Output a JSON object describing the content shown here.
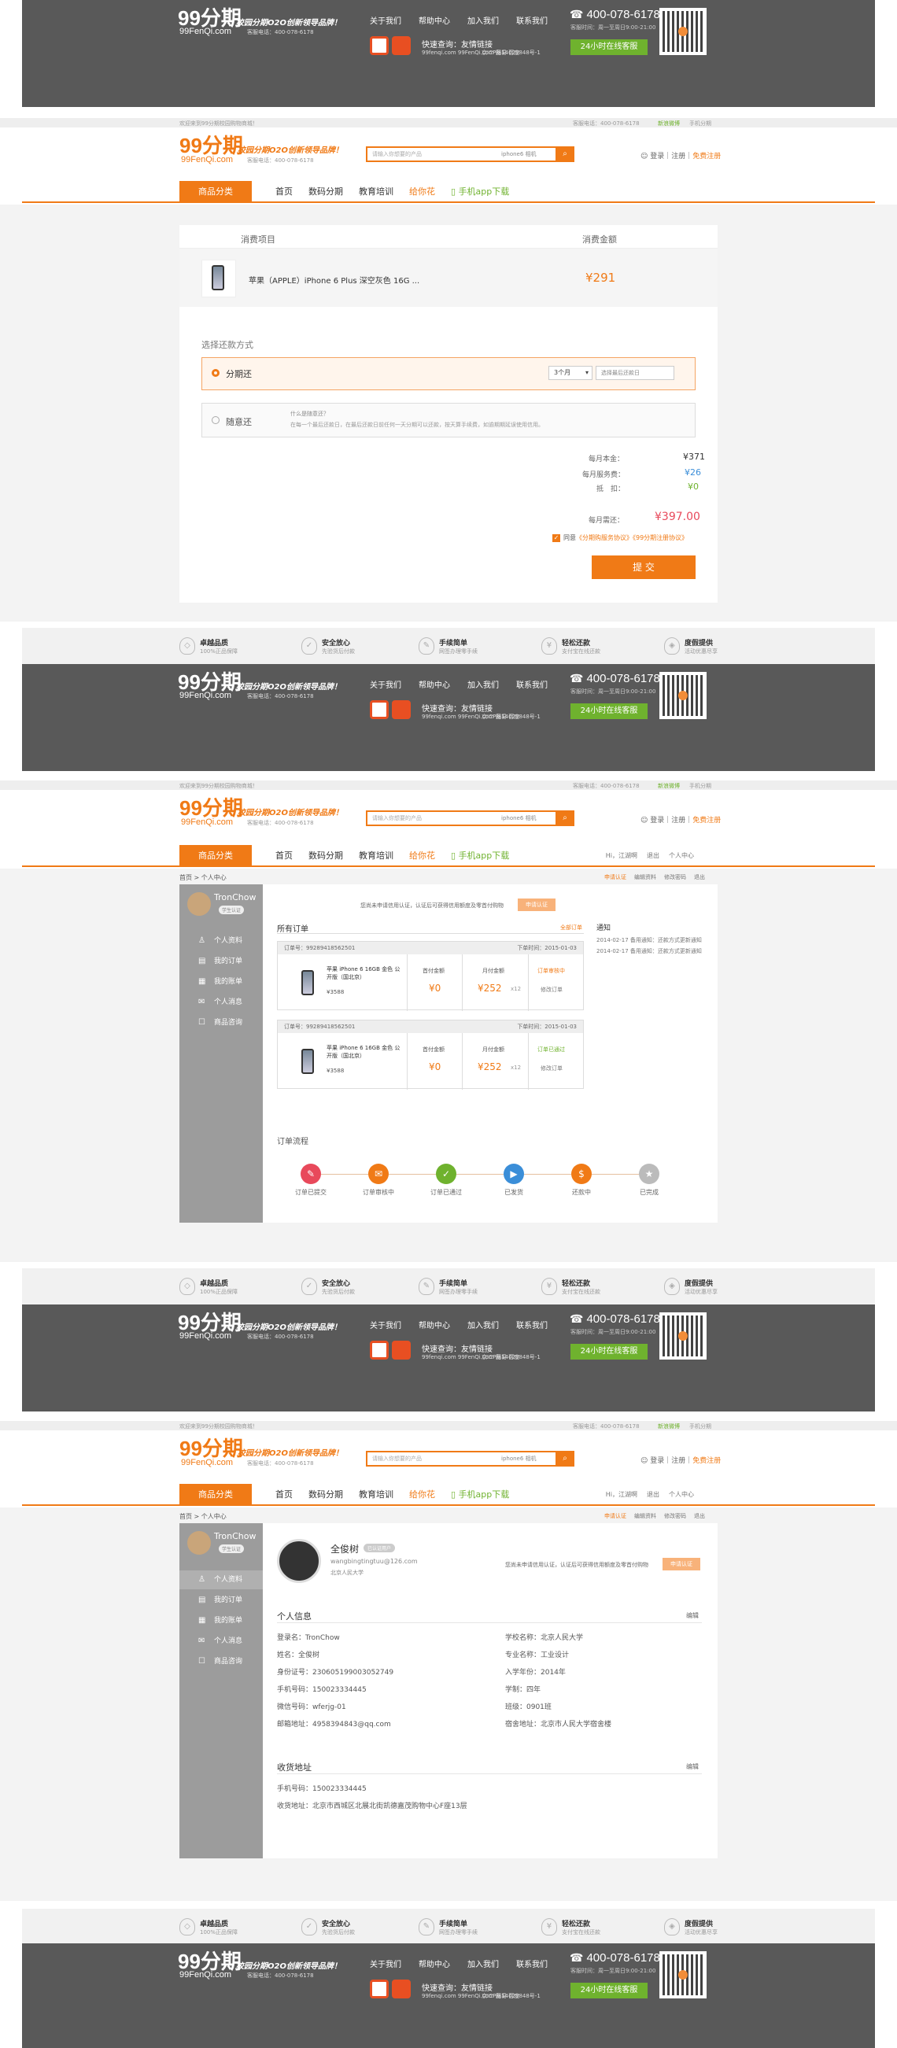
{
  "brand": {
    "logo": "99分期",
    "logo_sub": "99FenQi.com",
    "slogan": "校园分期O2O创新领导品牌！",
    "hotline_label": "客服电话：400-078-6178"
  },
  "footer": {
    "nav": [
      "关于我们",
      "帮助中心",
      "加入我们",
      "联系我们"
    ],
    "friend_label": "快速查询：友情链接",
    "friend_line2": "99fenqi.com  99FenQi.com  网易  百度",
    "icp": "京ICP备14029848号-1",
    "phone": "400-078-6178",
    "hours": "客服时间：周一至周日9:00-21:00",
    "online": "24小时在线客服"
  },
  "topstrip": {
    "left": "欢迎来到99分期校园购物商城！",
    "phone": "客服电话：400-078-6178",
    "follow": "新浪微博",
    "mobile": "手机分期"
  },
  "header": {
    "search_placeholder": "请输入你想要的产品",
    "keywords": "iphone6  相机",
    "login_prefix": "☺ 登录｜注册｜",
    "login_link": "免费注册"
  },
  "menu": {
    "category": "商品分类",
    "items": [
      "首页",
      "数码分期",
      "教育培训",
      "给你花"
    ],
    "app": "手机app下载",
    "right": [
      "Hi，江湖啊",
      "退出",
      "个人中心"
    ]
  },
  "features": [
    {
      "icon": "◇",
      "title": "卓越品质",
      "sub": "100%正品保障"
    },
    {
      "icon": "✓",
      "title": "安全放心",
      "sub": "先验货后付款"
    },
    {
      "icon": "✎",
      "title": "手续简单",
      "sub": "网签办理零手续"
    },
    {
      "icon": "¥",
      "title": "轻松还款",
      "sub": "支付宝在线还款"
    },
    {
      "icon": "◈",
      "title": "度假提供",
      "sub": "活动优惠尽享"
    }
  ],
  "order": {
    "col_item": "消费项目",
    "col_amount": "消费金额",
    "product": "苹果（APPLE）iPhone 6 Plus 深空灰色 16G ...",
    "price": "¥291",
    "repay_title": "选择还款方式",
    "opt1": "分期还",
    "period": "3个月",
    "date_ph": "选择最后还款日",
    "opt2": "随意还",
    "opt2_q": "什么是随意还？",
    "opt2_desc": "在每一个最后还款日，在最后还款日前任何一天分期可以还款，按天算手续费，如逾期期延误使用信用。",
    "base_label": "每月本金：",
    "base": "¥371",
    "fee_label": "每月服务费：",
    "fee": "¥26",
    "disc_label": "抵　扣：",
    "disc": "¥0",
    "monthly_label": "每月需还：",
    "monthly": "¥397.00",
    "agree": "同意",
    "agree_l1": "《分期购服务协议》",
    "agree_l2": "《99分期注册协议》",
    "submit": "提 交"
  },
  "center": {
    "breadcrumb": "首页 > 个人中心",
    "username": "TronChow",
    "level": "学生认证",
    "side": [
      {
        "icon": "♙",
        "label": "个人资料"
      },
      {
        "icon": "▤",
        "label": "我的订单"
      },
      {
        "icon": "▦",
        "label": "我的账单"
      },
      {
        "icon": "✉",
        "label": "个人消息"
      },
      {
        "icon": "☐",
        "label": "商品咨询"
      }
    ],
    "topline": [
      "申请认证",
      "编辑资料",
      "修改密码",
      "退出"
    ],
    "verify_tip": "您尚未申请信用认证，认证后可获得信用额度及零首付购物",
    "verify_btn": "申请认证"
  },
  "orders": {
    "title": "所有订单",
    "more": "全部订单",
    "rows": [
      {
        "no": "订单号：99289418562501",
        "time": "下单时间：2015-01-03",
        "name": "苹果 iPhone 6 16GB 金色 公开版（国北京）",
        "price": "¥3588",
        "first_lbl": "首付金额",
        "first": "¥0",
        "month_lbl": "月付金额",
        "month": "¥252",
        "x": "x12",
        "status": "订单审核中",
        "action": "修改订单"
      },
      {
        "no": "订单号：99289418562501",
        "time": "下单时间：2015-01-03",
        "name": "苹果 iPhone 6 16GB 金色 公开版（国北京）",
        "price": "¥3588",
        "first_lbl": "首付金额",
        "first": "¥0",
        "month_lbl": "月付金额",
        "month": "¥252",
        "x": "x12",
        "status": "订单已通过",
        "action": "修改订单"
      }
    ],
    "notice_title": "通知",
    "notices": [
      "2014-02-17  备用通知：还款方式更新通知",
      "2014-02-17  备用通知：还款方式更新通知"
    ],
    "flow_title": "订单流程",
    "steps": [
      {
        "icon": "✎",
        "label": "订单已提交",
        "color": "#e8495b"
      },
      {
        "icon": "✉",
        "label": "订单审核中",
        "color": "#f07a16"
      },
      {
        "icon": "✓",
        "label": "订单已通过",
        "color": "#6fb22e"
      },
      {
        "icon": "▶",
        "label": "已发货",
        "color": "#3b8ed8"
      },
      {
        "icon": "$",
        "label": "还款中",
        "color": "#f07a16"
      },
      {
        "icon": "★",
        "label": "已完成",
        "color": "#bbb"
      }
    ]
  },
  "profile": {
    "name": "全俊树",
    "tag": "已认证用户",
    "email": "wangbingtingtuu@126.com",
    "school_short": "北京人民大学",
    "personal_title": "个人信息",
    "edit": "编辑",
    "left": [
      "登录名：TronChow",
      "姓名：全俊树",
      "身份证号：230605199003052749",
      "手机号码：150023334445",
      "微信号码：wferjg-01",
      "邮箱地址：4958394843@qq.com"
    ],
    "right": [
      "学校名称：北京人民大学",
      "专业名称：工业设计",
      "入学年份：2014年",
      "学制：四年",
      "班级：0901班",
      "宿舍地址：北京市人民大学宿舍楼"
    ],
    "addr_title": "收货地址",
    "addr": [
      "手机号码：150023334445",
      "收货地址：北京市西城区北展北街凯德嘉茂购物中心F座13层"
    ]
  }
}
